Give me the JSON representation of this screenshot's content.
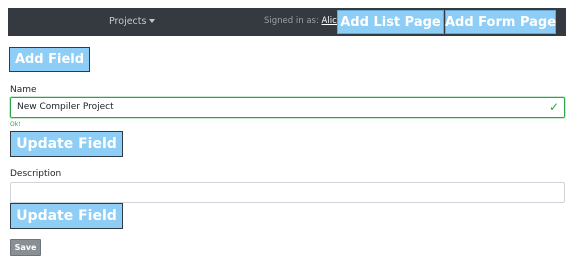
{
  "navbar": {
    "projects_label": "Projects",
    "signed_in_prefix": "Signed in as:",
    "signed_in_user": "Alice",
    "add_list_page_label": "Add List Page",
    "add_form_page_label": "Add Form Page"
  },
  "form": {
    "add_field_label": "Add Field",
    "name": {
      "label": "Name",
      "value": "New Compiler Project",
      "valid_message": "Ok!"
    },
    "update_field_label": "Update Field",
    "description": {
      "label": "Description",
      "value": ""
    },
    "save_label": "Save"
  },
  "colors": {
    "navbar_bg": "#343a40",
    "button_blue": "#8ecdf5",
    "valid_green": "#28a745",
    "save_gray": "#8a8f93"
  }
}
